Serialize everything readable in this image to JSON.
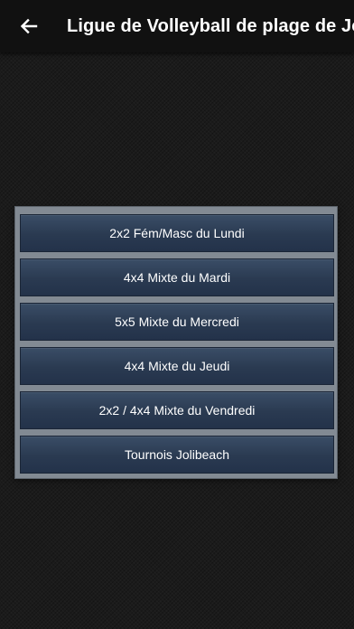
{
  "app_bar": {
    "title": "Ligue de Volleyball de plage de Jolibeach",
    "back_icon": "arrow-back-icon"
  },
  "menu": {
    "items": [
      {
        "label": "2x2 Fém/Masc du Lundi"
      },
      {
        "label": "4x4 Mixte du Mardi"
      },
      {
        "label": "5x5 Mixte du Mercredi"
      },
      {
        "label": "4x4 Mixte du Jeudi"
      },
      {
        "label": "2x2 / 4x4 Mixte du Vendredi"
      },
      {
        "label": "Tournois Jolibeach"
      }
    ]
  },
  "colors": {
    "app_bar_bg": "#111111",
    "panel_bg": "#828a93",
    "button_bg": "#2a3a51",
    "text": "#ffffff"
  }
}
